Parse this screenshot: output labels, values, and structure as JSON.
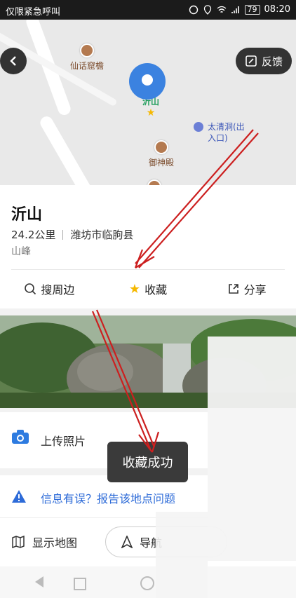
{
  "status_bar": {
    "carrier": "仅限紧急呼叫",
    "battery": "79",
    "time": "08:20"
  },
  "map": {
    "back_icon": "chevron-left-icon",
    "feedback_label": "反馈",
    "pois": [
      {
        "name": "仙话窟檐"
      },
      {
        "name": "沂山"
      },
      {
        "name": "御神殿"
      },
      {
        "name": "太清洞(出入口)"
      }
    ]
  },
  "place": {
    "title": "沂山",
    "distance": "24.2公里",
    "location": "潍坊市临朐县",
    "category": "山峰"
  },
  "actions": [
    {
      "label": "搜周边",
      "icon": "search-icon"
    },
    {
      "label": "收藏",
      "icon": "star-icon",
      "color": "#f5b800"
    },
    {
      "label": "分享",
      "icon": "share-icon"
    }
  ],
  "upload": {
    "label": "上传照片"
  },
  "info": {
    "label": "信息有误？报告该地点问题"
  },
  "bottom": {
    "show_map_label": "显示地图",
    "nav_label": "导航"
  },
  "toast": {
    "message": "收藏成功"
  },
  "colors": {
    "accent": "#2d6bd8",
    "annotation_arrow": "#cc1f1f"
  }
}
